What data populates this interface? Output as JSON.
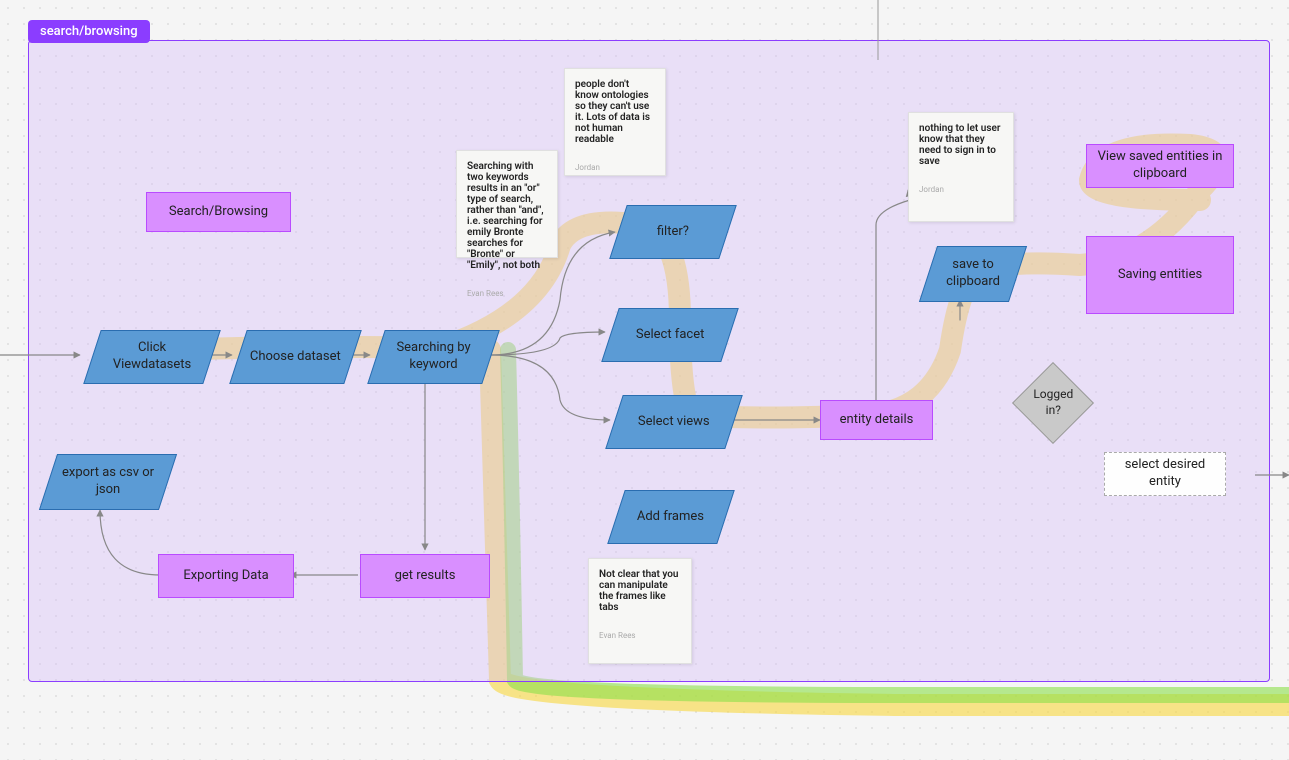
{
  "frame": {
    "label": "search/browsing"
  },
  "nodes": {
    "search_browsing": "Search/Browsing",
    "click_viewdatasets": "Click Viewdatasets",
    "choose_dataset": "Choose dataset",
    "searching_by_keyword": "Searching by keyword",
    "filter": "filter?",
    "select_facet": "Select facet",
    "select_views": "Select views",
    "add_frames": "Add frames",
    "entity_details": "entity details",
    "save_to_clipboard": "save to clipboard",
    "view_saved": "View saved entities in clipboard",
    "saving_entities": "Saving entities",
    "logged_in": "Logged in?",
    "select_desired_entity": "select desired entity",
    "get_results": "get results",
    "exporting_data": "Exporting Data",
    "export_csv_json": "export as csv or json"
  },
  "stickies": {
    "ontologies": {
      "text": "people don't know ontologies so they can't use it. Lots of data is not human readable",
      "author": "Jordan"
    },
    "keywords": {
      "text": "Searching with two keywords results in an \"or\" type of search, rather than \"and\", i.e. searching for emily Bronte searches for \"Bronte\" or \"Emily\", not both",
      "author": "Evan Rees"
    },
    "signin": {
      "text": "nothing to let user know that they need to sign in to save",
      "author": "Jordan"
    },
    "frames": {
      "text": "Not clear that you can manipulate the frames like tabs",
      "author": "Evan Rees"
    }
  },
  "colors": {
    "frame_border": "#8b3dff",
    "frame_fill": "rgba(215,190,250,0.4)",
    "tab_bg": "#8b3dff",
    "blue_fill": "#5b9bd5",
    "blue_border": "#2a6db0",
    "purple_fill": "#d98fff",
    "purple_border": "#b94bff",
    "grey_fill": "#c9c9c9",
    "sticky_bg": "#f7f7f5",
    "highlight_yellow": "#f7d94c",
    "highlight_green": "#8be04a"
  }
}
